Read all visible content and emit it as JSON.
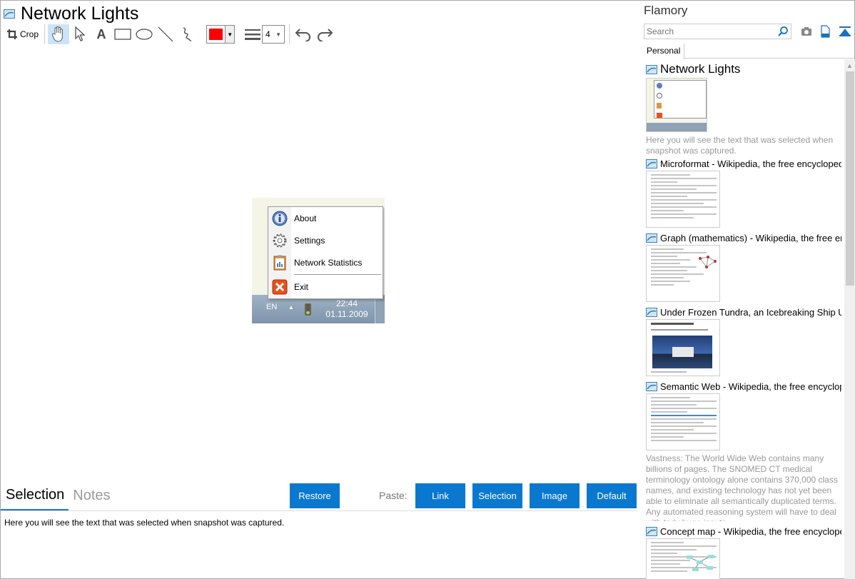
{
  "window": {
    "title": "Network Lights"
  },
  "toolbar": {
    "crop_label": "Crop",
    "text_tool": "A",
    "color": "#ff0000",
    "stroke_width": "4",
    "tools": [
      "hand-icon",
      "pointer-icon",
      "text-icon",
      "rectangle-icon",
      "ellipse-icon",
      "line-icon",
      "freehand-icon"
    ]
  },
  "snapshot": {
    "menu": [
      {
        "label": "About",
        "icon": "info-icon"
      },
      {
        "label": "Settings",
        "icon": "gear-icon"
      },
      {
        "label": "Network Statistics",
        "icon": "clipboard-icon"
      },
      {
        "label": "Exit",
        "icon": "close-icon"
      }
    ],
    "taskbar": {
      "lang": "EN",
      "time": "22:44",
      "date": "01.11.2009"
    }
  },
  "bottom": {
    "tabs": [
      "Selection",
      "Notes"
    ],
    "restore_label": "Restore",
    "paste_label": "Paste:",
    "paste_buttons": [
      "Link",
      "Selection",
      "Image",
      "Default"
    ],
    "selection_text": "Here you will see the text that was selected when snapshot was captured."
  },
  "sidebar": {
    "title": "Flamory",
    "search_placeholder": "Search",
    "tab": "Personal",
    "items": [
      {
        "title": "Network Lights",
        "desc": "Here you will see the text that was selected when snapshot was captured."
      },
      {
        "title": "Microformat - Wikipedia, the free encyclopedia",
        "desc": ""
      },
      {
        "title": "Graph (mathematics) - Wikipedia, the free ency",
        "desc": ""
      },
      {
        "title": "Under Frozen Tundra, an Icebreaking Ship Unco",
        "desc": ""
      },
      {
        "title": "Semantic Web - Wikipedia, the free encycloped",
        "desc": "Vastness: The World Wide Web contains many billions of pages. The SNOMED CT medical terminology ontology alone contains 370,000 class names, and existing technology has not yet been able to eliminate all semantically duplicated terms. Any automated reasoning system will have to deal with truly huge inputs."
      },
      {
        "title": "Concept map - Wikipedia, the free encyclopedia",
        "desc": ""
      }
    ]
  },
  "colors": {
    "accent": "#0b78d0",
    "tab_underline": "#1e78c8"
  }
}
